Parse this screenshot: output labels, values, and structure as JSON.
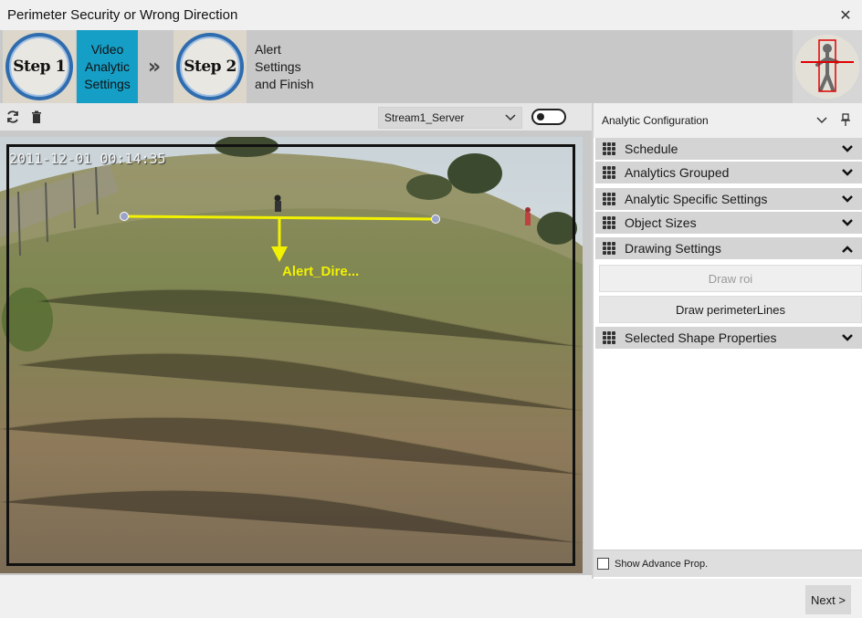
{
  "window": {
    "title": "Perimeter Security or Wrong Direction",
    "close_glyph": "✕"
  },
  "wizard": {
    "step1": {
      "badge": "Step 1",
      "label": "Video\nAnalytic\nSettings",
      "active_color": "#159ec6"
    },
    "separator_glyph": "»",
    "step2": {
      "badge": "Step 2",
      "label": "Alert\nSettings\nand Finish"
    },
    "thumbnail_icon": "perimeter-person-icon"
  },
  "toolbar": {
    "refresh_icon": "refresh-icon",
    "delete_icon": "trash-icon",
    "stream_select": {
      "value": "Stream1_Server"
    },
    "toggle": {
      "state": "off"
    }
  },
  "video": {
    "timestamp": "2011-12-01 00:14:35",
    "line_label": "Alert_Dire...",
    "line_color": "#f2f200"
  },
  "panel": {
    "title": "Analytic Configuration",
    "sections": [
      {
        "label": "Schedule",
        "expanded": false
      },
      {
        "label": "Analytics Grouped",
        "expanded": false
      },
      {
        "label": "Analytic Specific Settings",
        "expanded": false
      },
      {
        "label": "Object Sizes",
        "expanded": false
      },
      {
        "label": "Drawing Settings",
        "expanded": true
      },
      {
        "label": "Selected Shape Properties",
        "expanded": false
      }
    ],
    "draw_roi": "Draw roi",
    "draw_perimeter": "Draw perimeterLines",
    "advance_label": "Show Advance Prop.",
    "advance_checked": false
  },
  "footer": {
    "next_label": "Next >"
  }
}
